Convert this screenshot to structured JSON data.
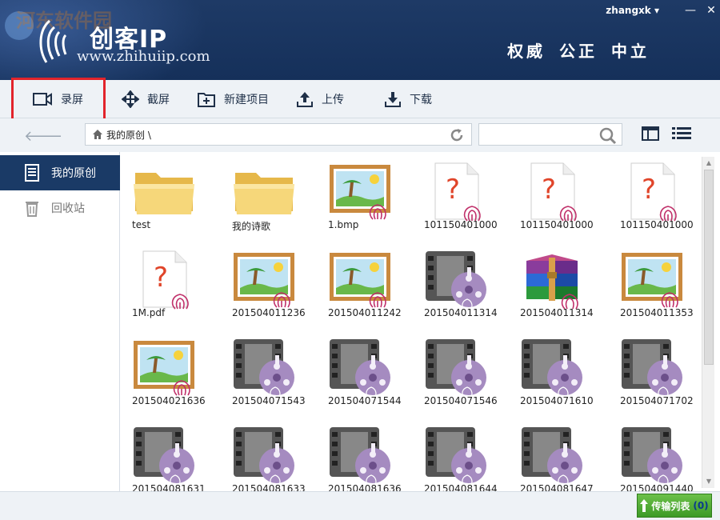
{
  "header": {
    "watermark": "河东软件园",
    "logo_text": "创客IP",
    "logo_url": "www.zhihuiip.com",
    "motto": "权威 公正 中立",
    "user": "zhangxk",
    "user_caret": "▾",
    "minimize": "—",
    "close": "✕"
  },
  "toolbar": {
    "record": "录屏",
    "screenshot": "截屏",
    "new_project": "新建项目",
    "upload": "上传",
    "download": "下载"
  },
  "address": {
    "path": "我的原创 \\",
    "back": "🡐",
    "search_placeholder": ""
  },
  "sidebar": {
    "items": [
      {
        "label": "我的原创",
        "icon": "document-icon"
      },
      {
        "label": "回收站",
        "icon": "recycle-bin-icon"
      }
    ]
  },
  "files": [
    {
      "name": "test",
      "type": "folder"
    },
    {
      "name": "我的诗歌",
      "type": "folder"
    },
    {
      "name": "1.bmp",
      "type": "image"
    },
    {
      "name": "101150401000",
      "type": "unknown"
    },
    {
      "name": "101150401000",
      "type": "unknown"
    },
    {
      "name": "101150401000",
      "type": "unknown"
    },
    {
      "name": "1M.pdf",
      "type": "unknown"
    },
    {
      "name": "201504011236",
      "type": "image"
    },
    {
      "name": "201504011242",
      "type": "image"
    },
    {
      "name": "201504011314",
      "type": "video"
    },
    {
      "name": "201504011314",
      "type": "archive"
    },
    {
      "name": "201504011353",
      "type": "image"
    },
    {
      "name": "201504021636",
      "type": "image"
    },
    {
      "name": "201504071543",
      "type": "video"
    },
    {
      "name": "201504071544",
      "type": "video"
    },
    {
      "name": "201504071546",
      "type": "video"
    },
    {
      "name": "201504071610",
      "type": "video"
    },
    {
      "name": "201504071702",
      "type": "video"
    },
    {
      "name": "201504081631",
      "type": "video"
    },
    {
      "name": "201504081633",
      "type": "video"
    },
    {
      "name": "201504081636",
      "type": "video"
    },
    {
      "name": "201504081644",
      "type": "video"
    },
    {
      "name": "201504081647",
      "type": "video"
    },
    {
      "name": "201504091440",
      "type": "video"
    }
  ],
  "footer": {
    "transfer_label": "传输列表",
    "transfer_count": "(0)"
  },
  "colors": {
    "header_bg": "#15305a",
    "accent_red": "#e2242b",
    "transfer_green": "#3d9a26"
  }
}
